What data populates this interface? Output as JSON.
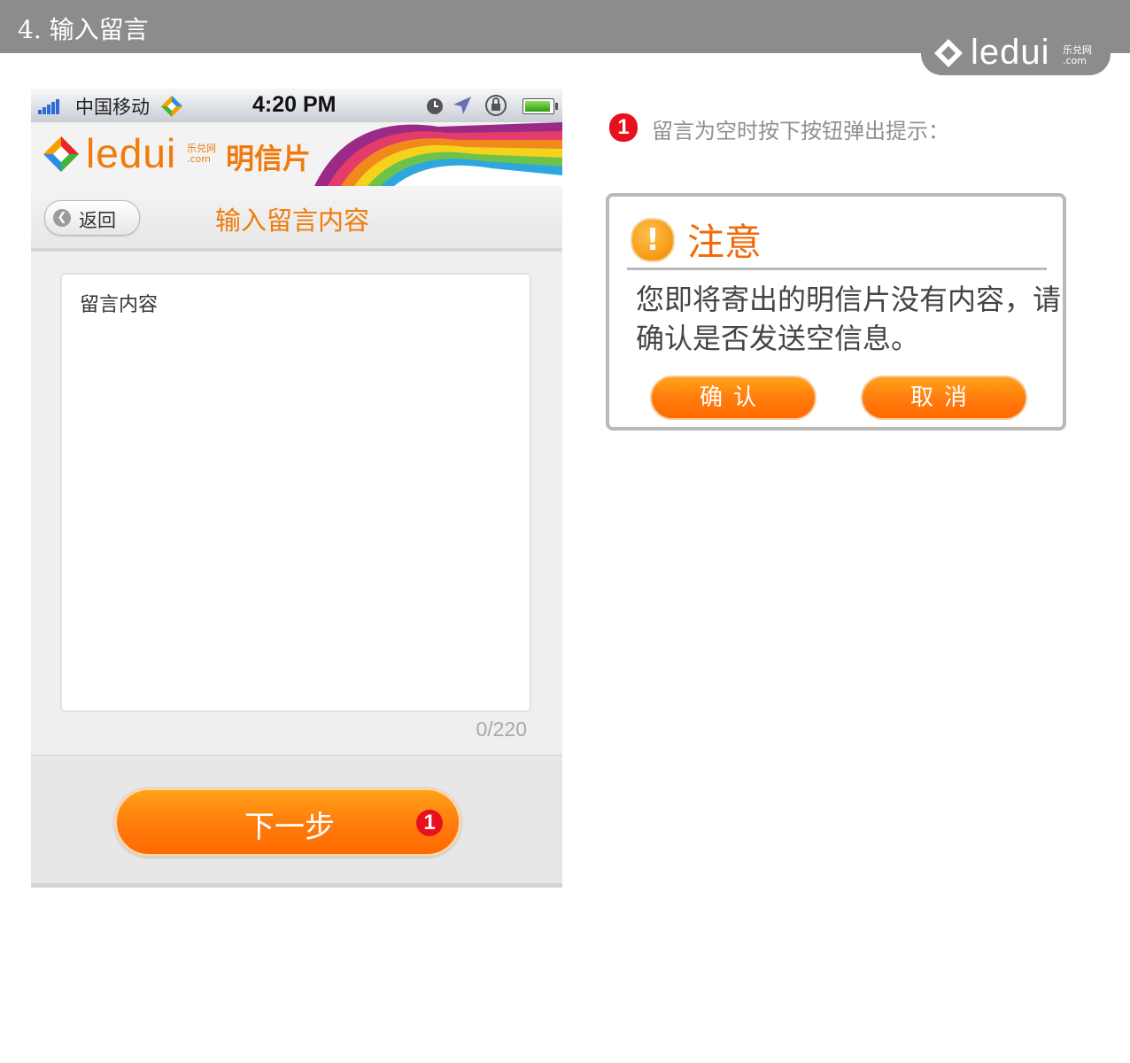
{
  "page": {
    "section_title": "4. 输入留言",
    "brand": {
      "word": "ledui",
      "cn": "乐兑网",
      "dotcom": ".com"
    }
  },
  "phone": {
    "status_bar": {
      "carrier": "中国移动",
      "time": "4:20 PM"
    },
    "banner": {
      "logo_word": "ledui",
      "logo_cn": "乐兑网",
      "logo_dotcom": ".com",
      "product": "明信片"
    },
    "navbar": {
      "back_label": "返回",
      "title": "输入留言内容"
    },
    "message": {
      "placeholder": "留言内容",
      "counter": "0/220"
    },
    "next_button": {
      "label": "下一步",
      "badge": "1"
    }
  },
  "annotation": {
    "badge": "1",
    "text": "留言为空时按下按钮弹出提示："
  },
  "dialog": {
    "title": "注意",
    "message": "您即将寄出的明信片没有内容，请确认是否发送空信息。",
    "confirm_label": "确认",
    "cancel_label": "取消"
  },
  "colors": {
    "accent": "#f07b0c",
    "badge": "#e8101c",
    "banner_grey": "#8c8c8c"
  }
}
